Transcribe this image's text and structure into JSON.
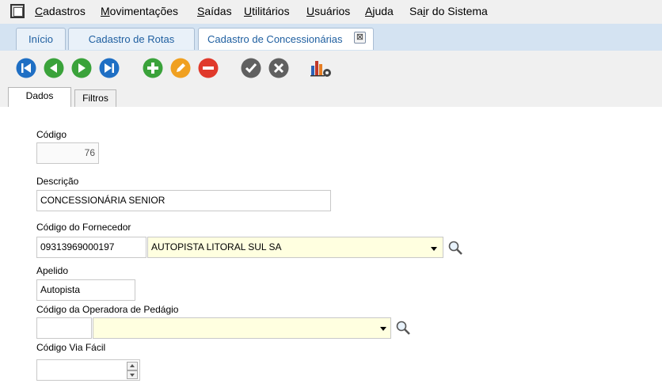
{
  "menu": {
    "items": [
      {
        "u": "C",
        "rest": "adastros"
      },
      {
        "u": "M",
        "rest": "ovimentações"
      },
      {
        "u": "S",
        "rest": "aídas"
      },
      {
        "u": "U",
        "rest": "tilitários"
      },
      {
        "u": "U",
        "rest": "suários"
      },
      {
        "u": "A",
        "rest": "juda"
      },
      {
        "pre": "Sa",
        "u": "i",
        "rest": "r do Sistema"
      }
    ]
  },
  "tabs": [
    "Início",
    "Cadastro de Rotas",
    "Cadastro de Concessionárias"
  ],
  "inner_tabs": {
    "dados": "Dados",
    "filtros": "Filtros"
  },
  "form": {
    "codigo_label": "Código",
    "codigo_value": "76",
    "descricao_label": "Descrição",
    "descricao_value": "CONCESSIONÁRIA SENIOR",
    "fornecedor_label": "Código do Fornecedor",
    "fornecedor_code": "09313969000197",
    "fornecedor_name": "AUTOPISTA LITORAL SUL SA",
    "apelido_label": "Apelido",
    "apelido_value": "Autopista",
    "operadora_label": "Código da Operadora de Pedágio",
    "operadora_code": "",
    "operadora_name": "",
    "viafacil_label": "Código Via Fácil",
    "viafacil_value": ""
  },
  "colors": {
    "nav_blue": "#1f6fc4",
    "green": "#3aa23a",
    "orange": "#f0a020",
    "red": "#e0392b",
    "gray": "#606060"
  }
}
